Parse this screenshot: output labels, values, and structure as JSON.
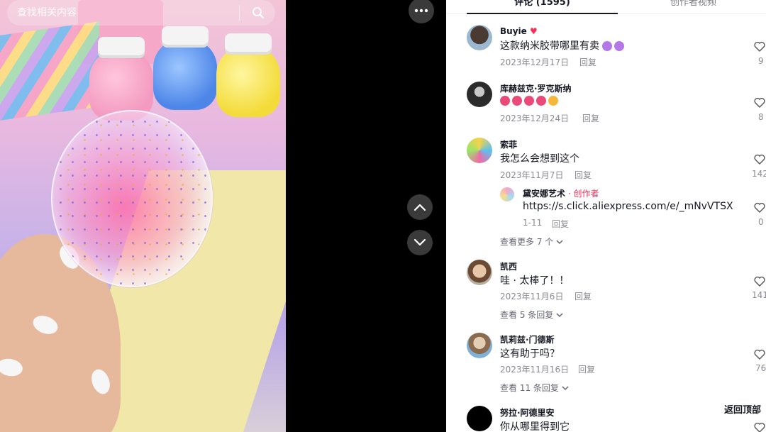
{
  "search": {
    "placeholder": "查找相关内容"
  },
  "tabs": {
    "comments": "评论 (1595)",
    "creator_videos": "创作者视频"
  },
  "comments": [
    {
      "user": "Buyie",
      "badge": "♥",
      "text": "这款纳米胶带哪里有卖",
      "emojis": [
        "#b477e6",
        "#b477e6"
      ],
      "date": "2023年12月17日",
      "reply_label": "回复",
      "likes": "9"
    },
    {
      "user": "库赫兹克·罗克斯纳",
      "emojis": [
        "#e94a7a",
        "#e94a7a",
        "#e94a7a",
        "#e94a7a",
        "#f6b83a"
      ],
      "date": "2023年12月24日",
      "reply_label": "回复",
      "likes": "8"
    },
    {
      "user": "索菲",
      "text": "我怎么会想到这个",
      "date": "2023年11月7日",
      "reply_label": "回复",
      "likes": "142",
      "reply": {
        "user": "黛安娜艺术",
        "creator_tag": " · 创作者",
        "text": "https://s.click.aliexpress.com/e/_mNvVTSX",
        "date": "1-11",
        "reply_label": "回复",
        "likes": "0"
      },
      "view_more": "查看更多 7 个"
    },
    {
      "user": "凯西",
      "text": "哇 · 太棒了！！",
      "date": "2023年11月6日",
      "reply_label": "回复",
      "likes": "141",
      "view_more": "查看 5 条回复"
    },
    {
      "user": "凯莉兹·门德斯",
      "text": "这有助于吗？",
      "date": "2023年11月16日",
      "reply_label": "回复",
      "likes": "76",
      "view_more": "查看 11 条回复"
    },
    {
      "user": "努拉·阿德里安",
      "text": "你从哪里得到它",
      "likes": ""
    }
  ],
  "back_to_top": "返回顶部",
  "colors": {
    "accent": "#fe2c55",
    "text": "#161823",
    "muted": "#8a8b91"
  }
}
